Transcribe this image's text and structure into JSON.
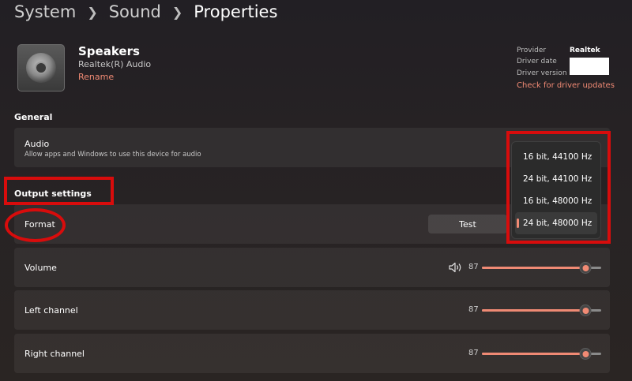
{
  "breadcrumb": [
    "System",
    "Sound",
    "Properties"
  ],
  "device": {
    "name": "Speakers",
    "subtitle": "Realtek(R) Audio",
    "rename_label": "Rename",
    "icon": "speaker-device-icon"
  },
  "driver": {
    "provider_label": "Provider",
    "provider_value": "Realtek",
    "date_label": "Driver date",
    "version_label": "Driver version",
    "update_link": "Check for driver updates"
  },
  "general": {
    "title": "General",
    "audio_label": "Audio",
    "audio_desc": "Allow apps and Windows to use this device for audio"
  },
  "output": {
    "title": "Output settings",
    "format_label": "Format",
    "test_label": "Test",
    "format_options": [
      "16 bit, 44100 Hz",
      "24 bit, 44100 Hz",
      "16 bit, 48000 Hz",
      "24 bit, 48000 Hz"
    ],
    "selected_option": "24 bit, 48000 Hz",
    "volume_label": "Volume",
    "volume_value": "87",
    "left_label": "Left channel",
    "left_value": "87",
    "right_label": "Right channel",
    "right_value": "87",
    "volume_icon": "speaker-volume-icon"
  },
  "colors": {
    "accent": "#f08a74",
    "annotation": "#d80c0c"
  }
}
